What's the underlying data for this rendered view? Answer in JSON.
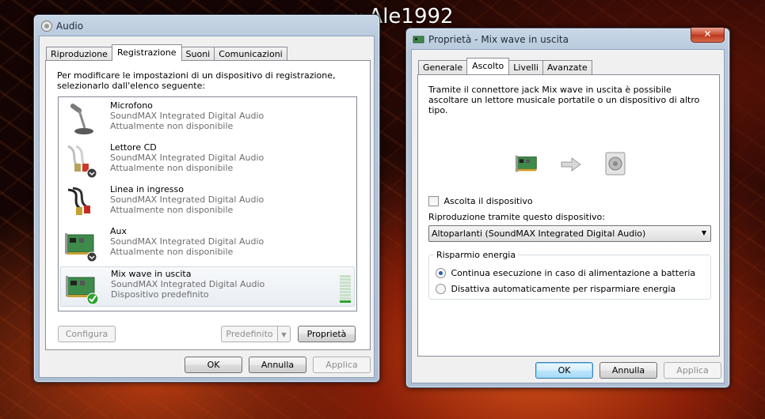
{
  "watermark": {
    "close": "×",
    "text": "Ale1992"
  },
  "audio": {
    "title": "Audio",
    "tabs": [
      "Riproduzione",
      "Registrazione",
      "Suoni",
      "Comunicazioni"
    ],
    "intro": "Per modificare le impostazioni di un dispositivo di registrazione, selezionarlo dall'elenco seguente:",
    "devices": [
      {
        "name": "Microfono",
        "driver": "SoundMAX Integrated Digital Audio",
        "status": "Attualmente non disponibile",
        "icon": "microphone-icon"
      },
      {
        "name": "Lettore CD",
        "driver": "SoundMAX Integrated Digital Audio",
        "status": "Attualmente non disponibile",
        "icon": "cd-cable-icon"
      },
      {
        "name": "Linea in ingresso",
        "driver": "SoundMAX Integrated Digital Audio",
        "status": "Attualmente non disponibile",
        "icon": "rca-cable-icon"
      },
      {
        "name": "Aux",
        "driver": "SoundMAX Integrated Digital Audio",
        "status": "Attualmente non disponibile",
        "icon": "sound-card-icon"
      },
      {
        "name": "Mix wave in uscita",
        "driver": "SoundMAX Integrated Digital Audio",
        "status": "Dispositivo predefinito",
        "icon": "sound-card-icon"
      }
    ],
    "buttons": {
      "configure": "Configura",
      "default": "Predefinito",
      "properties": "Proprietà",
      "ok": "OK",
      "cancel": "Annulla",
      "apply": "Applica"
    }
  },
  "props": {
    "title": "Proprietà - Mix wave in uscita",
    "tabs": [
      "Generale",
      "Ascolto",
      "Livelli",
      "Avanzate"
    ],
    "description": "Tramite il connettore jack Mix wave in uscita è possibile ascoltare un lettore musicale portatile o un dispositivo di altro tipo.",
    "listen_label": "Ascolta il dispositivo",
    "playback_label": "Riproduzione tramite questo dispositivo:",
    "playback_value": "Altoparlanti (SoundMAX Integrated Digital Audio)",
    "power_group": "Risparmio energia",
    "power_options": [
      "Continua esecuzione in caso di alimentazione a batteria",
      "Disattiva automaticamente per risparmiare energia"
    ],
    "buttons": {
      "ok": "OK",
      "cancel": "Annulla",
      "apply": "Applica"
    }
  },
  "colors": {
    "accent": "#3c7fb1",
    "meter_on": "#2fa32f",
    "default_check": "#2fa32f"
  }
}
